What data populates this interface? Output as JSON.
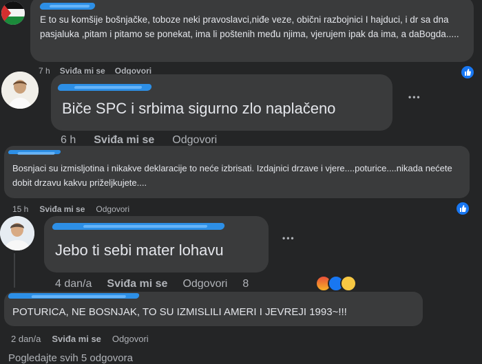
{
  "comments": [
    {
      "text": "E to su komšije bošnjačke, toboze neki pravoslavci,niđe veze, obični razbojnici I hajduci, i dr sa dna pasjaluka ,pitam i pitamo se ponekat, ima li poštenih među njima, vjerujem ipak da ima, a daBogda.....",
      "time": "7 h",
      "like": "Sviđa mi se",
      "reply": "Odgovori"
    },
    {
      "text": "Biče SPC i srbima sigurno zlo naplačeno",
      "time": "6 h",
      "like": "Sviđa mi se",
      "reply": "Odgovori",
      "more": "•••"
    },
    {
      "text": "Bosnjaci su izmisljotina i nikakve deklaracije to neće izbrisati. Izdajnici drzave i vjere....poturice....nikada nećete dobit drzavu kakvu priželjkujete....",
      "time": "15 h",
      "like": "Sviđa mi se",
      "reply": "Odgovori"
    },
    {
      "text": "Jebo ti sebi mater lohavu",
      "time": "4 dan/a",
      "like": "Sviđa mi se",
      "reply": "Odgovori",
      "reaction_count": "8",
      "more": "•••"
    },
    {
      "text": "POTURICA, NE BOSNJAK, TO SU IZMISLILI AMERI I JEVREJI 1993~!!!",
      "time": "2 dan/a",
      "like": "Sviđa mi se",
      "reply": "Odgovori"
    }
  ],
  "view_replies": "Pogledajte svih 5 odgovora",
  "colors": {
    "background": "#242526",
    "bubble": "#3a3b3c",
    "accent": "#1877f2"
  }
}
